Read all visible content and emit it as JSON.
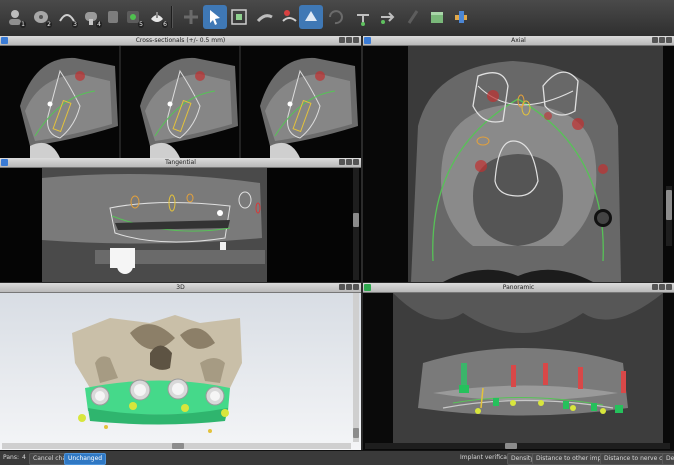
{
  "toolbar": {
    "buttons": [
      {
        "icon": "patient-icon",
        "badge": "1"
      },
      {
        "icon": "volume-icon",
        "badge": "2"
      },
      {
        "icon": "curve-icon",
        "badge": "3"
      },
      {
        "icon": "implant-icon",
        "badge": "4"
      },
      {
        "icon": "sleeve-icon",
        "badge": ""
      },
      {
        "icon": "guide-icon",
        "badge": "5"
      },
      {
        "icon": "export-icon",
        "badge": "6"
      },
      {
        "icon": "add-implant-icon",
        "badge": ""
      },
      {
        "icon": "select-icon",
        "badge": ""
      },
      {
        "icon": "measure-icon",
        "badge": ""
      },
      {
        "icon": "nerve-icon",
        "badge": ""
      },
      {
        "icon": "annotate-icon",
        "badge": ""
      },
      {
        "icon": "view-3d-icon",
        "badge": ""
      },
      {
        "icon": "undo-icon",
        "badge": ""
      },
      {
        "icon": "snap-icon",
        "badge": ""
      },
      {
        "icon": "rotate-icon",
        "badge": ""
      },
      {
        "icon": "screw-icon",
        "badge": ""
      },
      {
        "icon": "box-icon",
        "badge": ""
      },
      {
        "icon": "tool-icon",
        "badge": ""
      }
    ]
  },
  "panels": {
    "cross_sectionals": {
      "title": "Cross-sectionals (+/- 0.5 mm)"
    },
    "axial": {
      "title": "Axial"
    },
    "tangential": {
      "title": "Tangential"
    },
    "view3d": {
      "title": "3D"
    },
    "panoramic": {
      "title": "Panoramic"
    }
  },
  "status": {
    "pans_label": "Pans:",
    "pans_value": "4",
    "cancel_change": "Cancel change",
    "unchanged": "Unchanged",
    "implant_verification": "Implant verification:",
    "density": "Density",
    "distance_implants": "Distance to other implants",
    "distance_nerve": "Distance to nerve canal",
    "more": "Den"
  },
  "colors": {
    "panel_badge_blue": "#3a7bd5",
    "panel_badge_green": "#2fa84f",
    "nerve_curve": "#5fd35f",
    "implant_yellow": "#e3c23c",
    "red_marker": "#d63a3a"
  }
}
